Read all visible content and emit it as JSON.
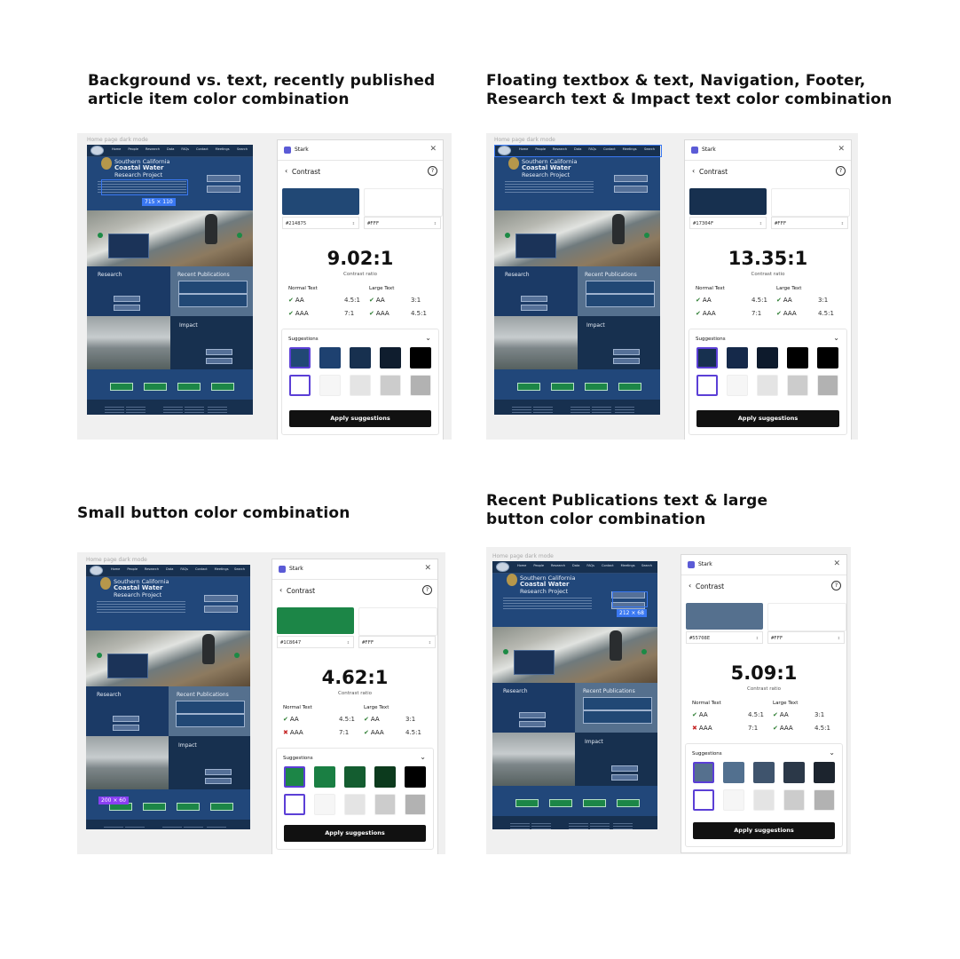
{
  "panels": [
    {
      "heading": [
        "Background vs. text, recently published",
        "article item color combination"
      ],
      "caption": "Home page dark mode",
      "plugin": "Stark",
      "back_title": "Contrast",
      "fg_hex": "#214875",
      "bg_hex": "#FFF",
      "fg_color": "#214875",
      "ratio": "9.02:1",
      "ratio_label": "Contrast ratio",
      "normal_text": "Normal Text",
      "large_text": "Large Text",
      "normal": [
        {
          "label": "AA",
          "value": "4.5:1",
          "pass": true
        },
        {
          "label": "AAA",
          "value": "7:1",
          "pass": true
        }
      ],
      "large": [
        {
          "label": "AA",
          "value": "3:1",
          "pass": true
        },
        {
          "label": "AAA",
          "value": "4.5:1",
          "pass": true
        }
      ],
      "suggestions_label": "Suggestions",
      "apply_label": "Apply suggestions",
      "dark_suggestions": [
        "#214875",
        "#1e4170",
        "#17304f",
        "#0f1d2e",
        "#000000"
      ],
      "dim_label": "715 × 110"
    },
    {
      "heading": [
        "Floating textbox & text, Navigation, Footer,",
        "Research text & Impact text color combination"
      ],
      "caption": "Home page dark mode",
      "plugin": "Stark",
      "back_title": "Contrast",
      "fg_hex": "#17304F",
      "bg_hex": "#FFF",
      "fg_color": "#17304f",
      "ratio": "13.35:1",
      "ratio_label": "Contrast ratio",
      "normal_text": "Normal Text",
      "large_text": "Large Text",
      "normal": [
        {
          "label": "AA",
          "value": "4.5:1",
          "pass": true
        },
        {
          "label": "AAA",
          "value": "7:1",
          "pass": true
        }
      ],
      "large": [
        {
          "label": "AA",
          "value": "3:1",
          "pass": true
        },
        {
          "label": "AAA",
          "value": "4.5:1",
          "pass": true
        }
      ],
      "suggestions_label": "Suggestions",
      "apply_label": "Apply suggestions",
      "dark_suggestions": [
        "#17304f",
        "#15294a",
        "#0d1a2c",
        "#000000",
        "#000000"
      ],
      "dim_label": ""
    },
    {
      "heading": [
        "Small button color combination"
      ],
      "caption": "Home page dark mode",
      "plugin": "Stark",
      "back_title": "Contrast",
      "fg_hex": "#1C8647",
      "bg_hex": "#FFF",
      "fg_color": "#1c8647",
      "ratio": "4.62:1",
      "ratio_label": "Contrast ratio",
      "normal_text": "Normal Text",
      "large_text": "Large Text",
      "normal": [
        {
          "label": "AA",
          "value": "4.5:1",
          "pass": true
        },
        {
          "label": "AAA",
          "value": "7:1",
          "pass": false
        }
      ],
      "large": [
        {
          "label": "AA",
          "value": "3:1",
          "pass": true
        },
        {
          "label": "AAA",
          "value": "4.5:1",
          "pass": true
        }
      ],
      "suggestions_label": "Suggestions",
      "apply_label": "Apply suggestions",
      "dark_suggestions": [
        "#1c8647",
        "#1a7f43",
        "#145d30",
        "#0c3a1d",
        "#000000"
      ],
      "dim_label": "200 × 60"
    },
    {
      "heading": [
        "Recent Publications text & large",
        "button color combination"
      ],
      "caption": "Home page dark mode",
      "plugin": "Stark",
      "back_title": "Contrast",
      "fg_hex": "#55708E",
      "bg_hex": "#FFF",
      "fg_color": "#55708e",
      "ratio": "5.09:1",
      "ratio_label": "Contrast ratio",
      "normal_text": "Normal Text",
      "large_text": "Large Text",
      "normal": [
        {
          "label": "AA",
          "value": "4.5:1",
          "pass": true
        },
        {
          "label": "AAA",
          "value": "7:1",
          "pass": false
        }
      ],
      "large": [
        {
          "label": "AA",
          "value": "3:1",
          "pass": true
        },
        {
          "label": "AAA",
          "value": "4.5:1",
          "pass": true
        }
      ],
      "suggestions_label": "Suggestions",
      "apply_label": "Apply suggestions",
      "dark_suggestions": [
        "#55708e",
        "#52708f",
        "#3f546d",
        "#2b3848",
        "#1c242e"
      ],
      "dim_label": "212 × 68"
    }
  ],
  "site": {
    "nav": [
      "Home",
      "People",
      "Research",
      "Data",
      "FAQs",
      "Contact",
      "Meetings"
    ],
    "search": "Search",
    "title1": "Southern California",
    "title2": "Coastal Water",
    "title3": "Research Project",
    "research": "Research",
    "publications": "Recent Publications",
    "impact": "Impact"
  },
  "light_suggestions": [
    "#ffffff",
    "#f6f6f6",
    "#e4e4e4",
    "#cccccc",
    "#b2b2b2"
  ]
}
